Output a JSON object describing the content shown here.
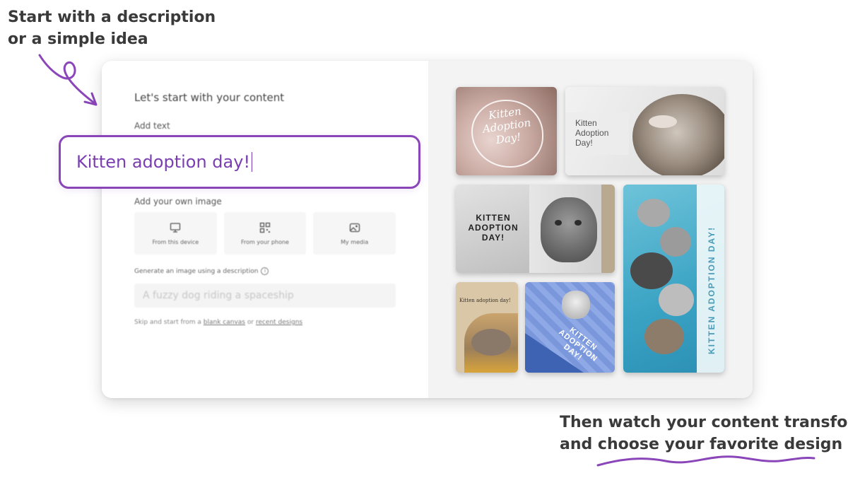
{
  "callouts": {
    "top_line1": "Start with a description",
    "top_line2": "or a simple idea",
    "bottom_line1": "Then watch your content transform",
    "bottom_line2": "and choose your favorite design"
  },
  "form": {
    "heading": "Let's start with your content",
    "add_text_label": "Add text",
    "text_value": "Kitten adoption day!",
    "add_image_label": "Add your own image",
    "upload_options": [
      {
        "label": "From this device",
        "icon": "monitor-icon"
      },
      {
        "label": "From your phone",
        "icon": "qr-code-icon"
      },
      {
        "label": "My media",
        "icon": "image-icon"
      }
    ],
    "generate_label": "Generate an image using a description",
    "description_placeholder": "A fuzzy dog riding a spaceship",
    "skip_prefix": "Skip and start from a ",
    "blank_canvas_link": "blank canvas",
    "skip_or": " or ",
    "recent_designs_link": "recent designs"
  },
  "designs": {
    "tile1_text": "Kitten Adoption Day!",
    "tile2_line1": "Kitten",
    "tile2_line2": "Adoption",
    "tile2_line3": "Day!",
    "tile3_line1": "KITTEN",
    "tile3_line2": "ADOPTION",
    "tile3_line3": "DAY!",
    "tile4_text": "Kitten adoption day!",
    "tile5_line1": "KITTEN",
    "tile5_line2": "ADOPTION",
    "tile5_line3": "DAY!",
    "tile6_text": "KITTEN ADOPTION DAY!"
  },
  "colors": {
    "accent_purple": "#8a46b9",
    "card_right_bg": "#f3f3f3"
  }
}
